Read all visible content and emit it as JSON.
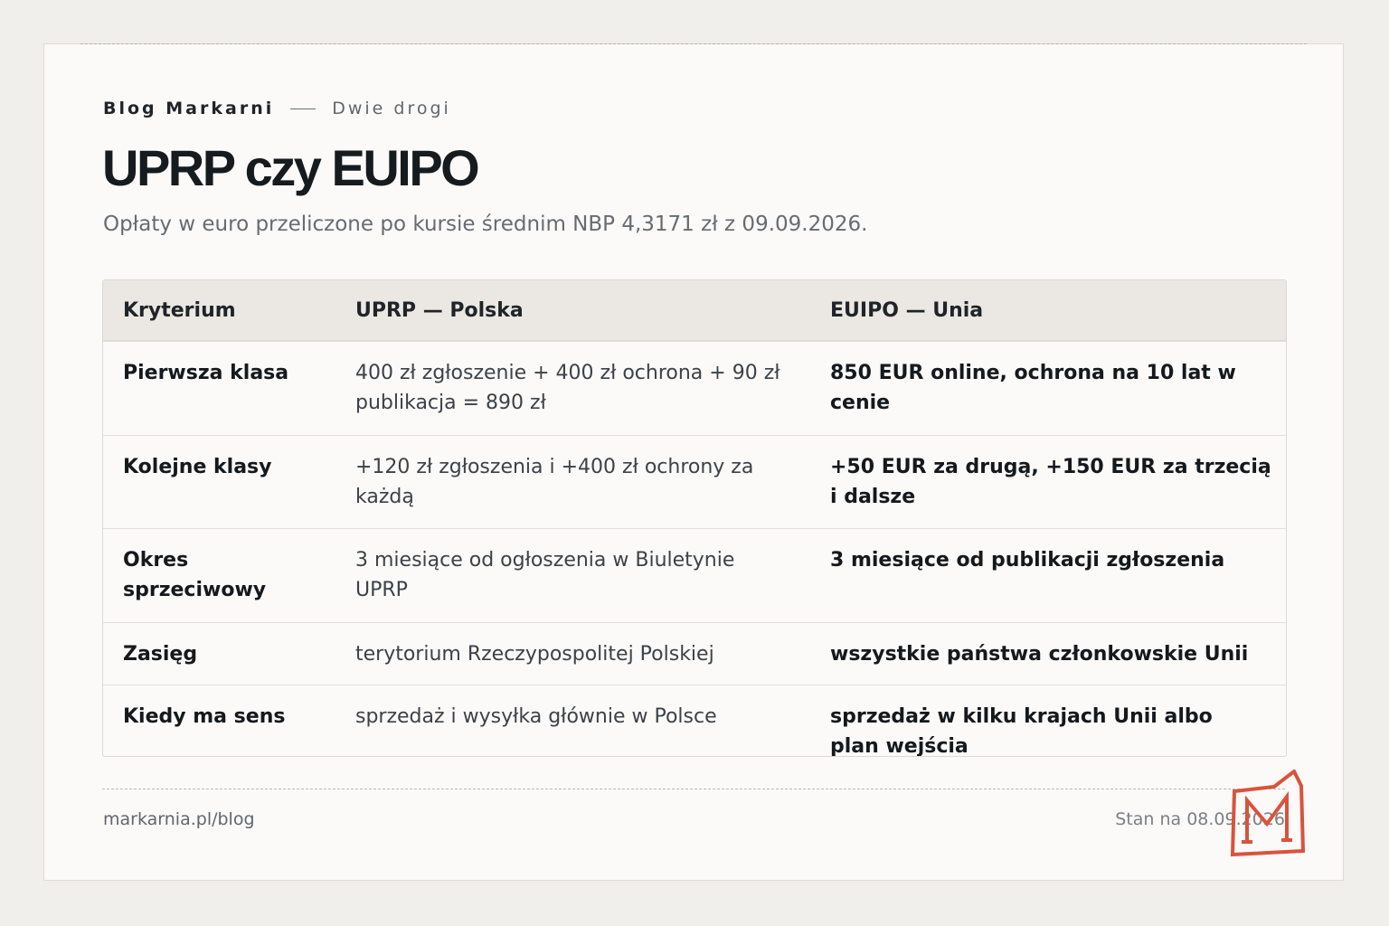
{
  "header": {
    "brand": "Blog Markarni",
    "section": "Dwie drogi",
    "title": "UPRP czy EUIPO",
    "subtitle": "Opłaty w euro przeliczone po kursie średnim NBP 4,3171 zł z 09.09.2026."
  },
  "table": {
    "columns": [
      "Kryterium",
      "UPRP — Polska",
      "EUIPO — Unia"
    ],
    "rows": [
      [
        "Pierwsza klasa",
        "400 zł zgłoszenie + 400 zł ochrona + 90 zł publikacja = 890 zł",
        "850 EUR online, ochrona na 10 lat w cenie"
      ],
      [
        "Kolejne klasy",
        "+120 zł zgłoszenia i +400 zł ochrony za każdą",
        "+50 EUR za drugą, +150 EUR za trzecią i dalsze"
      ],
      [
        "Okres sprzeciwowy",
        "3 miesiące od ogłoszenia w Biuletynie UPRP",
        "3 miesiące od publikacji zgłoszenia"
      ],
      [
        "Zasięg",
        "terytorium Rzeczypospolitej Polskiej",
        "wszystkie państwa członkowskie Unii"
      ],
      [
        "Kiedy ma sens",
        "sprzedaż i wysyłka głównie w Polsce",
        "sprzedaż w kilku krajach Unii albo plan wejścia"
      ]
    ]
  },
  "footer": {
    "url": "markarnia.pl/blog",
    "status": "Stan na 08.09.2026"
  },
  "colors": {
    "accent": "#d9533c",
    "text": "#14191e",
    "muted": "#656c74"
  },
  "logo": {
    "icon": "markarnia-m-logo"
  }
}
